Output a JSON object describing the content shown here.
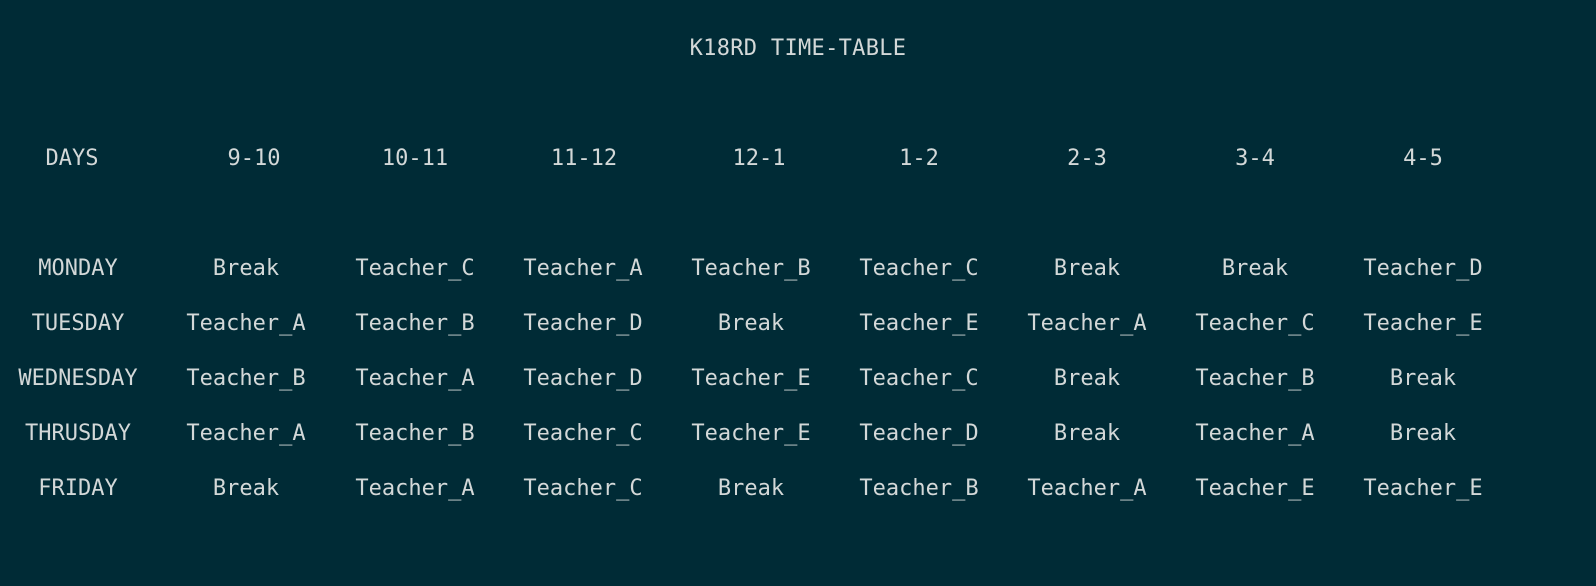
{
  "title": "K18RD TIME-TABLE",
  "header": [
    "DAYS",
    "9-10",
    "10-11",
    "11-12",
    "12-1",
    "1-2",
    "2-3",
    "3-4",
    "4-5"
  ],
  "rows": [
    [
      "MONDAY",
      "Break",
      "Teacher_C",
      "Teacher_A",
      "Teacher_B",
      "Teacher_C",
      "Break",
      "Break",
      "Teacher_D"
    ],
    [
      "TUESDAY",
      "Teacher_A",
      "Teacher_B",
      "Teacher_D",
      "Break",
      "Teacher_E",
      "Teacher_A",
      "Teacher_C",
      "Teacher_E"
    ],
    [
      "WEDNESDAY",
      "Teacher_B",
      "Teacher_A",
      "Teacher_D",
      "Teacher_E",
      "Teacher_C",
      "Break",
      "Teacher_B",
      "Break"
    ],
    [
      "THRUSDAY",
      "Teacher_A",
      "Teacher_B",
      "Teacher_C",
      "Teacher_E",
      "Teacher_D",
      "Break",
      "Teacher_A",
      "Break"
    ],
    [
      "FRIDAY",
      "Break",
      "Teacher_A",
      "Teacher_C",
      "Break",
      "Teacher_B",
      "Teacher_A",
      "Teacher_E",
      "Teacher_E"
    ]
  ],
  "colors": {
    "background": "#002b36",
    "text": "#d3d8d8"
  }
}
